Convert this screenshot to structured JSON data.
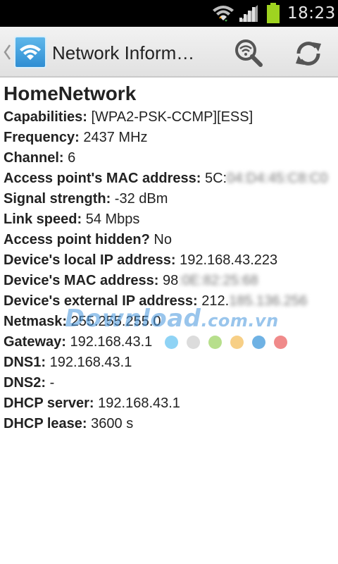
{
  "status_bar": {
    "time": "18:23"
  },
  "action_bar": {
    "title": "Network Inform…"
  },
  "network": {
    "name": "HomeNetwork",
    "rows": [
      {
        "label": "Capabilities:",
        "value": "[WPA2-PSK-CCMP][ESS]"
      },
      {
        "label": "Frequency:",
        "value": "2437 MHz"
      },
      {
        "label": "Channel:",
        "value": "6"
      },
      {
        "label": "Access point's MAC address:",
        "value": "5C:",
        "masked": "04:D4:45:C8:C0"
      },
      {
        "label": "Signal strength:",
        "value": "-32 dBm"
      },
      {
        "label": "Link speed:",
        "value": "54 Mbps"
      },
      {
        "label": "Access point hidden?",
        "value": "No"
      },
      {
        "label": "Device's local IP address:",
        "value": "192.168.43.223"
      },
      {
        "label": "Device's MAC address:",
        "value": "98",
        "masked": ":0E:82:25:68"
      },
      {
        "label": "Device's external IP address:",
        "value": "212.",
        "masked": "185.136.256"
      },
      {
        "label": "Netmask:",
        "value": "255.255.255.0"
      },
      {
        "label": "Gateway:",
        "value": "192.168.43.1"
      },
      {
        "label": "DNS1:",
        "value": "192.168.43.1"
      },
      {
        "label": "DNS2:",
        "value": "-"
      },
      {
        "label": "DHCP server:",
        "value": "192.168.43.1"
      },
      {
        "label": "DHCP lease:",
        "value": "3600 s"
      }
    ]
  },
  "watermark": {
    "main": "Download",
    "suffix": ".com.vn"
  },
  "colors": {
    "status_bar_bg": "#000000",
    "battery": "#9fd320",
    "app_icon": "#2f8ed3",
    "watermark_dots": [
      "#8fd3f5",
      "#dcdcdc",
      "#b7df8c",
      "#f7cf86",
      "#6fb2e4",
      "#f08a8a"
    ]
  }
}
